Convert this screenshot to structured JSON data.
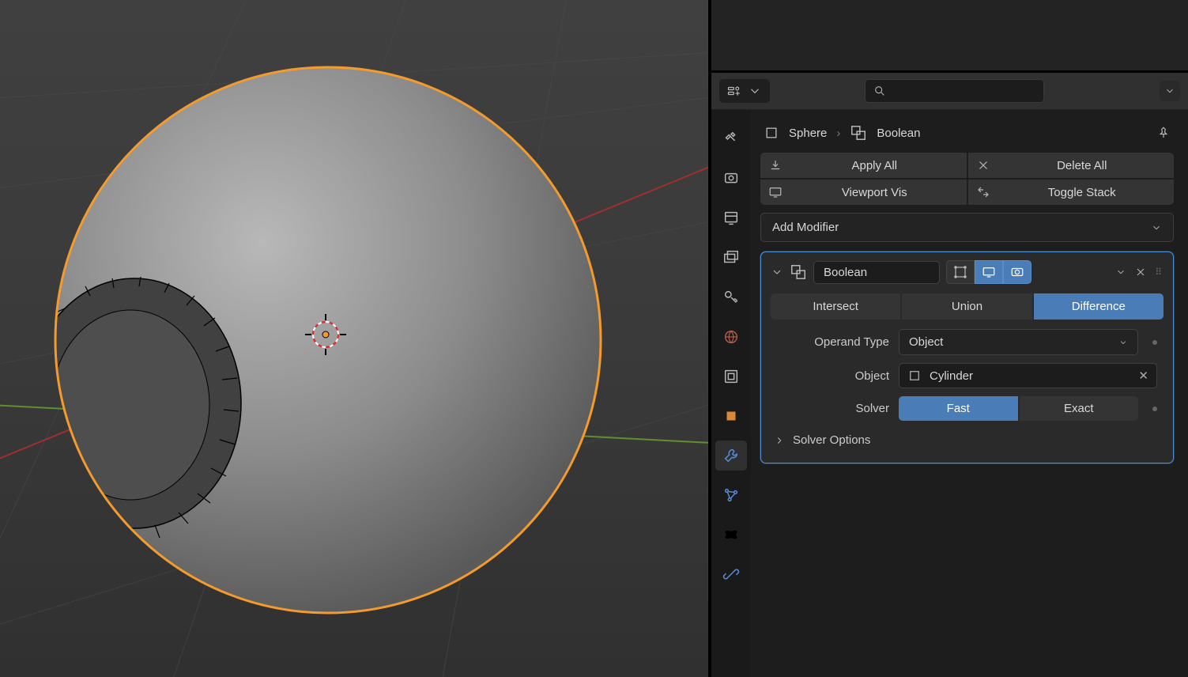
{
  "breadcrumb": {
    "object": "Sphere",
    "modifier": "Boolean"
  },
  "buttons": {
    "apply_all": "Apply All",
    "delete_all": "Delete All",
    "viewport_vis": "Viewport Vis",
    "toggle_stack": "Toggle Stack"
  },
  "add_modifier": "Add Modifier",
  "modifier": {
    "name": "Boolean",
    "operations": {
      "intersect": "Intersect",
      "union": "Union",
      "difference": "Difference",
      "selected": "difference"
    },
    "operand_type": {
      "label": "Operand Type",
      "value": "Object"
    },
    "object": {
      "label": "Object",
      "value": "Cylinder"
    },
    "solver": {
      "label": "Solver",
      "fast": "Fast",
      "exact": "Exact",
      "selected": "fast"
    },
    "solver_options": "Solver Options"
  },
  "search": {
    "placeholder": ""
  },
  "colors": {
    "accent": "#4a7db8",
    "outline": "#f39b2c"
  }
}
